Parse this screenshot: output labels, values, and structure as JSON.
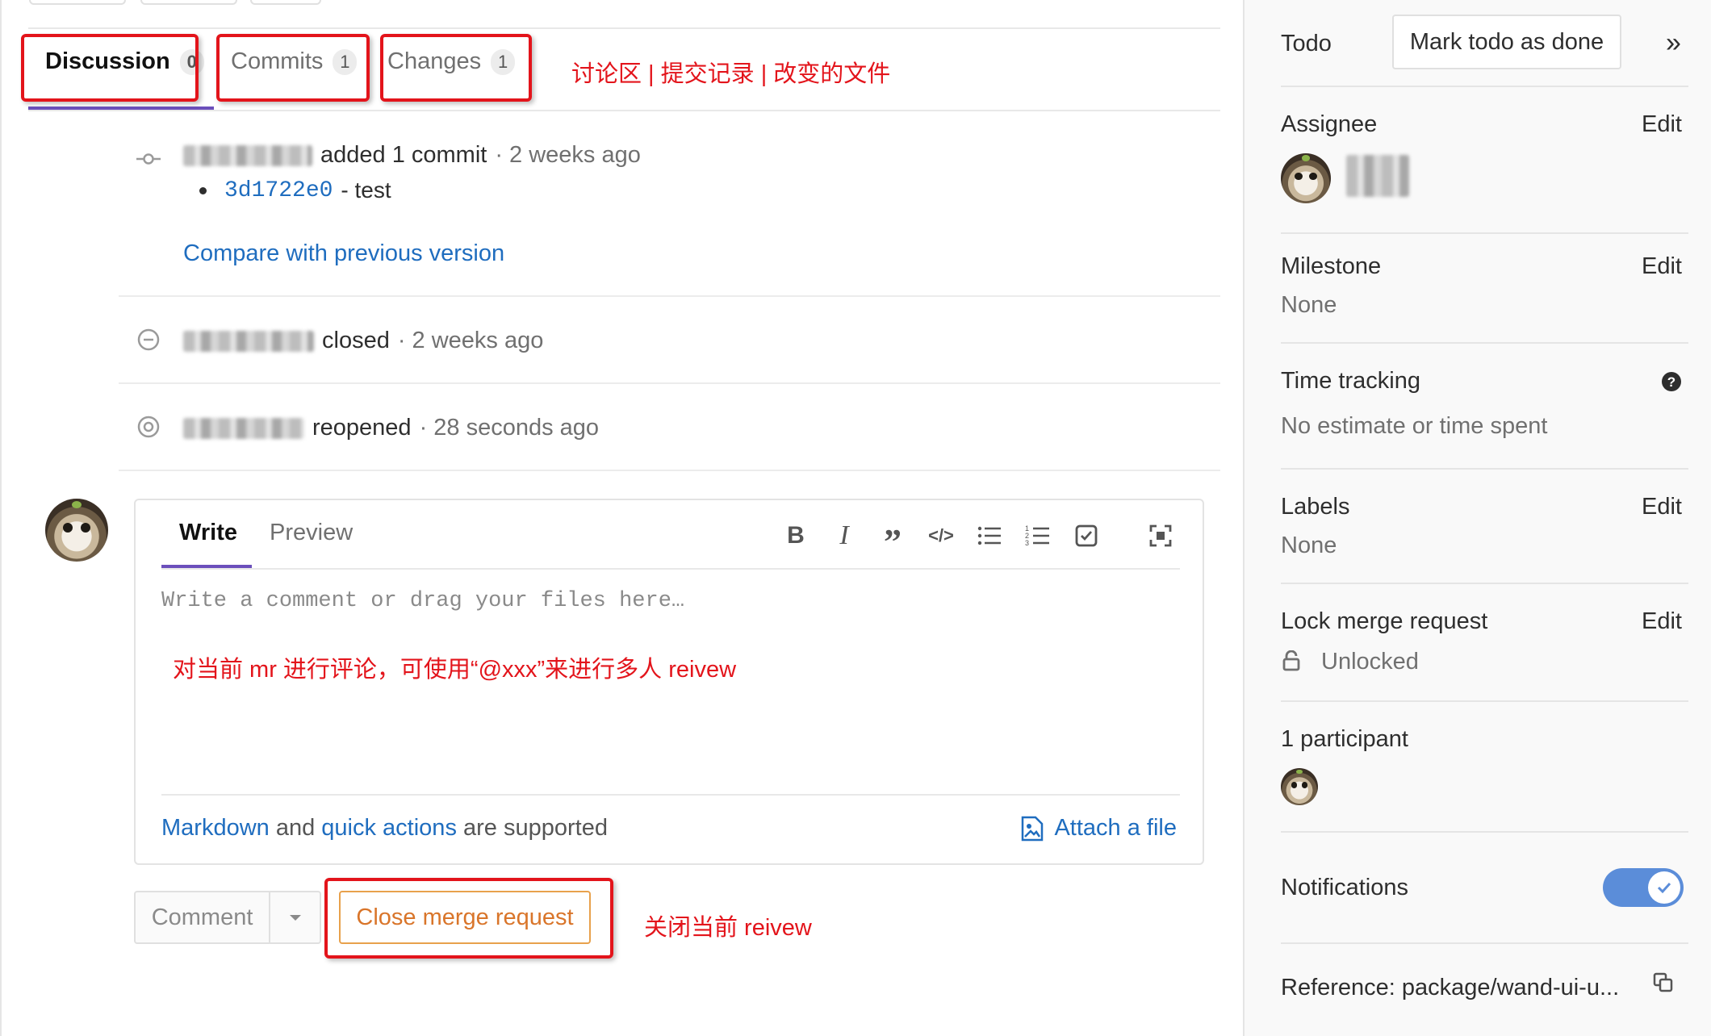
{
  "tabs": [
    {
      "label": "Discussion",
      "count": "0"
    },
    {
      "label": "Commits",
      "count": "1"
    },
    {
      "label": "Changes",
      "count": "1"
    }
  ],
  "annotations": {
    "tabs_note": "讨论区 | 提交记录 | 改变的文件",
    "comment_note": "对当前 mr 进行评论，可使用“@xxx”来进行多人 reivew",
    "close_note": "关闭当前 reivew"
  },
  "timeline": {
    "commit_event": {
      "action": "added 1 commit",
      "time": "· 2 weeks ago",
      "commit_sha": "3d1722e0",
      "commit_msg": "- test",
      "compare_link": "Compare with previous version"
    },
    "closed_event": {
      "action": "closed",
      "time": "· 2 weeks ago"
    },
    "reopened_event": {
      "action": "reopened",
      "time": "· 28 seconds ago"
    }
  },
  "comment": {
    "tab_write": "Write",
    "tab_preview": "Preview",
    "placeholder": "Write a comment or drag your files here…",
    "markdown_link": "Markdown",
    "and_text": "and",
    "quick_actions_link": "quick actions",
    "supported_text": "are supported",
    "attach_label": "Attach a file",
    "toolbar": [
      "bold-icon",
      "italic-icon",
      "quote-icon",
      "code-icon",
      "bullet-list-icon",
      "numbered-list-icon",
      "task-list-icon",
      "fullscreen-icon"
    ]
  },
  "buttons": {
    "comment": "Comment",
    "close_mr": "Close merge request"
  },
  "sidebar": {
    "todo_label": "Todo",
    "todo_button": "Mark todo as done",
    "collapse": "»",
    "assignee_title": "Assignee",
    "edit": "Edit",
    "milestone_title": "Milestone",
    "milestone_value": "None",
    "time_tracking_title": "Time tracking",
    "time_tracking_value": "No estimate or time spent",
    "labels_title": "Labels",
    "labels_value": "None",
    "lock_title": "Lock merge request",
    "lock_value": "Unlocked",
    "participants_title": "1 participant",
    "notifications_title": "Notifications",
    "notifications_on": true,
    "reference": "Reference: package/wand-ui-u..."
  },
  "colors": {
    "accent": "#6b4fbb",
    "link": "#1f6dbf",
    "annotation": "#e3141b",
    "close_btn": "#d9752a",
    "toggle": "#5b8dd9"
  }
}
